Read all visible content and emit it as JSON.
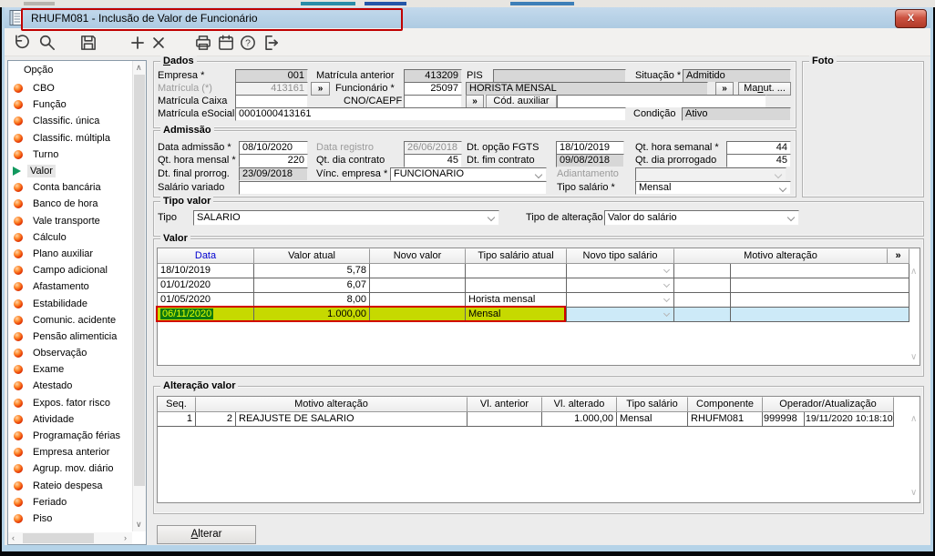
{
  "window": {
    "title": "RHUFM081 - Inclusão de Valor de Funcionário",
    "close": "X"
  },
  "toolbar": {
    "icons": [
      "undo",
      "search",
      "save",
      "add",
      "delete",
      "print",
      "calendar",
      "help",
      "exit"
    ]
  },
  "sidebar": {
    "header": "Opção",
    "selected": "Valor",
    "items": [
      "CBO",
      "Função",
      "Classific. única",
      "Classific. múltipla",
      "Turno",
      "Valor",
      "Conta bancária",
      "Banco de hora",
      "Vale transporte",
      "Cálculo",
      "Plano auxiliar",
      "Campo adicional",
      "Afastamento",
      "Estabilidade",
      "Comunic. acidente",
      "Pensão alimenticia",
      "Observação",
      "Exame",
      "Atestado",
      "Expos. fator risco",
      "Atividade",
      "Programação férias",
      "Empresa anterior",
      "Agrup. mov. diário",
      "Rateio despesa",
      "Feriado",
      "Piso"
    ]
  },
  "dados": {
    "legend_d": "D",
    "legend_rest": "ados",
    "empresa": {
      "label": "Empresa *",
      "value": "001"
    },
    "matricula": {
      "label": "Matrícula (*)",
      "value": "413161"
    },
    "matricula_caixa": {
      "label": "Matrícula Caixa",
      "value": ""
    },
    "matricula_esocial": {
      "label": "Matrícula eSocial",
      "value": "0001000413161"
    },
    "matricula_anterior": {
      "label": "Matrícula anterior",
      "value": "413209"
    },
    "funcionario": {
      "label": "Funcionário *",
      "value": "25097",
      "nome": "HORISTA MENSAL"
    },
    "cno_caepf": {
      "label": "CNO/CAEPF",
      "value": ""
    },
    "cod_auxiliar": {
      "label": "Cód. auxiliar",
      "value": ""
    },
    "pis": {
      "label": "PIS",
      "value": ""
    },
    "situacao": {
      "label": "Situação *",
      "value": "Admitido"
    },
    "condicao": {
      "label": "Condição",
      "value": "Ativo"
    },
    "lookup": "»",
    "manut": {
      "pre": "Ma",
      "mn": "n",
      "post": "ut. ..."
    }
  },
  "foto": {
    "legend": "Foto"
  },
  "admissao": {
    "legend": "Admissão",
    "data_admissao": {
      "label": "Data admissão *",
      "value": "08/10/2020"
    },
    "data_registro": {
      "label": "Data registro",
      "value": "26/06/2018"
    },
    "dt_opcao_fgts": {
      "label": "Dt. opção FGTS",
      "value": "18/10/2019"
    },
    "qt_hora_semanal": {
      "label": "Qt. hora semanal *",
      "value": "44"
    },
    "qt_hora_mensal": {
      "label": "Qt. hora mensal *",
      "value": "220"
    },
    "qt_dia_contrato": {
      "label": "Qt. dia contrato",
      "value": "45"
    },
    "dt_fim_contrato": {
      "label": "Dt. fim contrato",
      "value": "09/08/2018"
    },
    "qt_dia_prorrogado": {
      "label": "Qt. dia prorrogado",
      "value": "45"
    },
    "dt_final_prorrog": {
      "label": "Dt. final prorrog.",
      "value": "23/09/2018"
    },
    "vinc_empresa": {
      "label": "Vínc. empresa *",
      "value": "FUNCIONARIO"
    },
    "adiantamento": {
      "label": "Adiantamento",
      "value": ""
    },
    "salario_variado": {
      "label": "Salário variado",
      "value": ""
    },
    "tipo_salario": {
      "label": "Tipo salário *",
      "value": "Mensal"
    }
  },
  "tipo_valor": {
    "legend": "Tipo valor",
    "tipo": {
      "label": "Tipo",
      "value": "SALARIO"
    },
    "tipo_alteracao": {
      "label": "Tipo de alteração",
      "value": "Valor do salário"
    }
  },
  "valor": {
    "legend": "Valor",
    "headers": [
      "Data",
      "Valor atual",
      "Novo valor",
      "Tipo salário atual",
      "Novo tipo salário",
      "Motivo alteração",
      "»"
    ],
    "rows": [
      {
        "data": "18/10/2019",
        "valor_atual": "5,78",
        "novo_valor": "",
        "tipo_salario_atual": "",
        "novo_tipo_salario": "",
        "motivo_cod": "",
        "motivo": ""
      },
      {
        "data": "01/01/2020",
        "valor_atual": "6,07",
        "novo_valor": "",
        "tipo_salario_atual": "",
        "novo_tipo_salario": "",
        "motivo_cod": "",
        "motivo": ""
      },
      {
        "data": "01/05/2020",
        "valor_atual": "8,00",
        "novo_valor": "",
        "tipo_salario_atual": "Horista mensal",
        "novo_tipo_salario": "",
        "motivo_cod": "",
        "motivo": ""
      },
      {
        "data": "06/11/2020",
        "valor_atual": "1.000,00",
        "novo_valor": "",
        "tipo_salario_atual": "Mensal",
        "novo_tipo_salario": "",
        "motivo_cod": "",
        "motivo": ""
      }
    ]
  },
  "alteracao_valor": {
    "legend": "Alteração valor",
    "headers": [
      "Seq.",
      "Motivo alteração",
      "Vl. anterior",
      "Vl. alterado",
      "Tipo salário",
      "Componente",
      "Operador/Atualização"
    ],
    "rows": [
      {
        "seq": "1",
        "motivo_cod": "2",
        "motivo": "REAJUSTE DE SALARIO",
        "vl_anterior": "",
        "vl_alterado": "1.000,00",
        "tipo_salario": "Mensal",
        "componente": "RHUFM081",
        "operador": "999998",
        "atualizacao": "19/11/2020 10:18:10"
      }
    ]
  },
  "footer": {
    "alterar_initial": "A",
    "alterar_rest": "lterar"
  },
  "colors": {
    "titlebar": "#b8d0e4",
    "annotation": "#c00000",
    "highlight_row": "#c6d900",
    "highlight_date_bg": "#0e7a0e",
    "highlight_date_text": "#e4ff00",
    "new_cells": "#cdeaf8"
  }
}
